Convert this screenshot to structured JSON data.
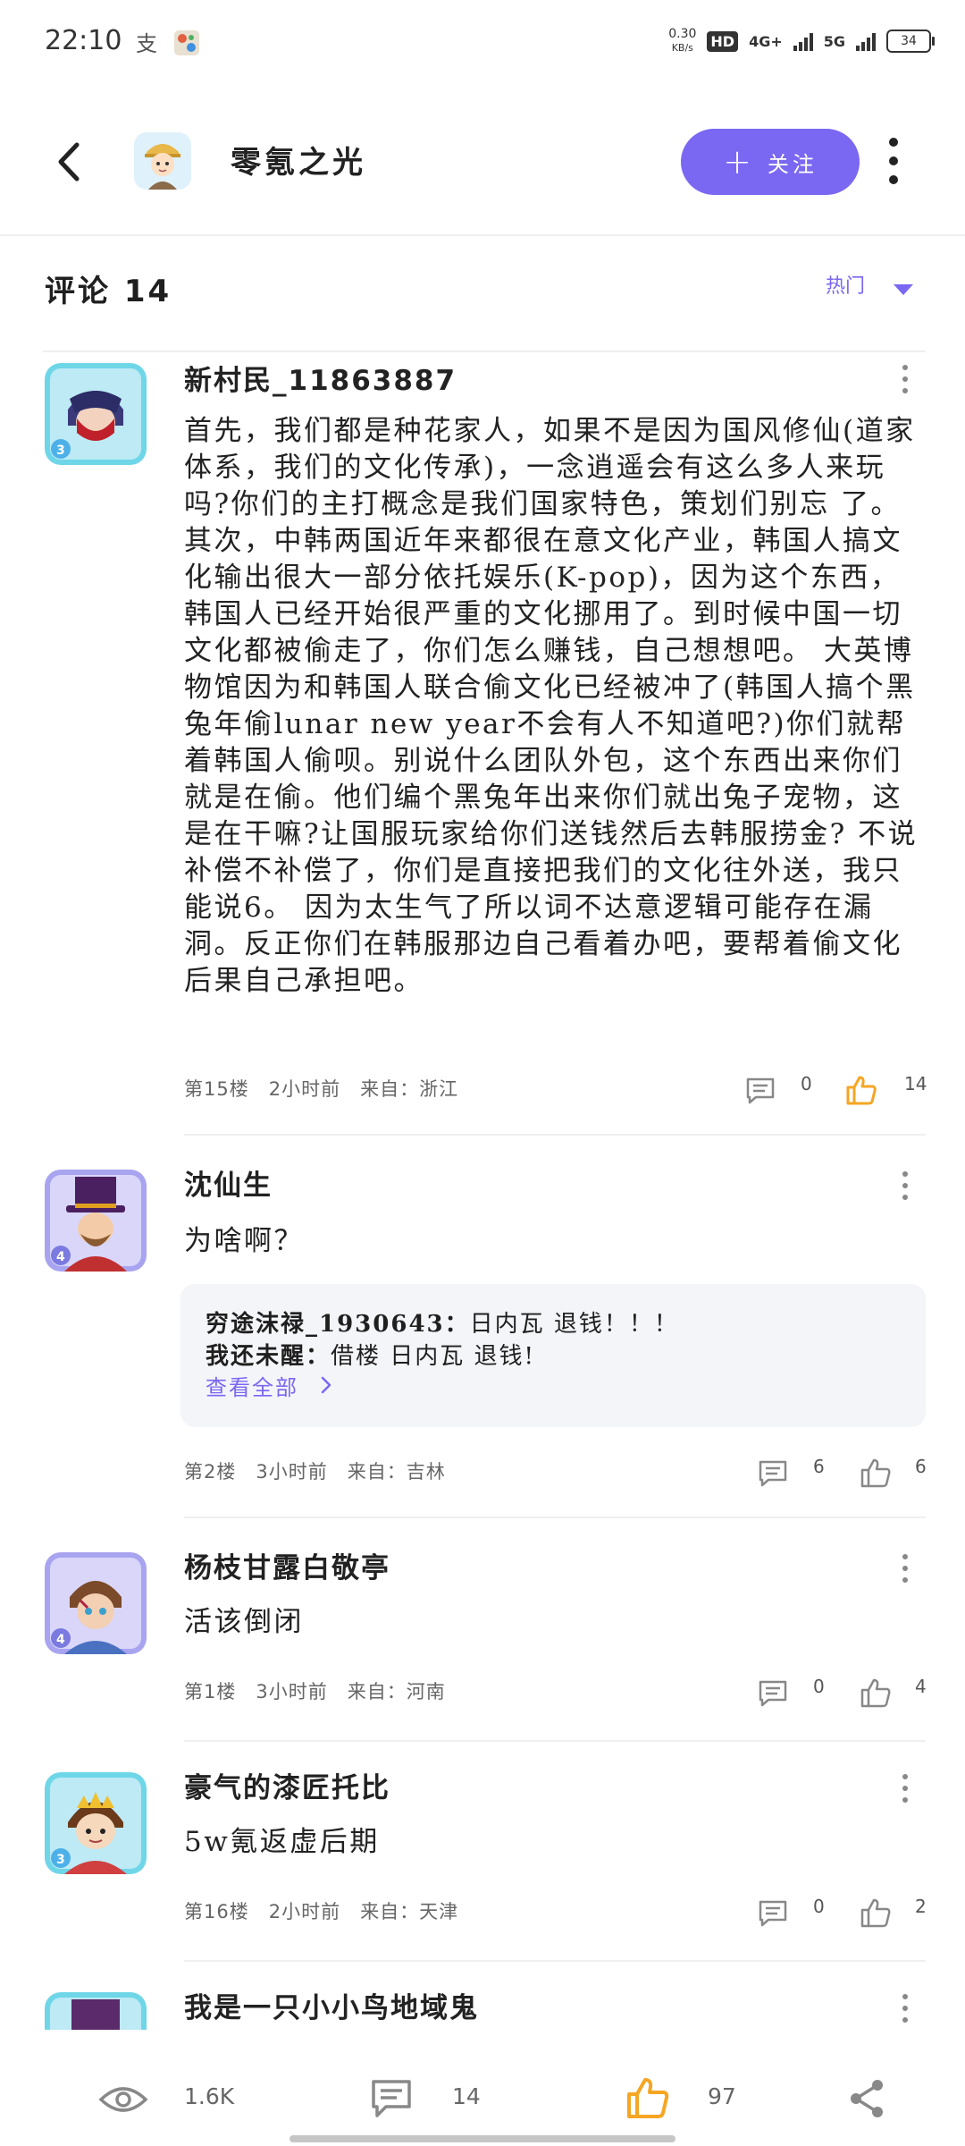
{
  "status_bar": {
    "time": "22:10",
    "net_speed_value": "0.30",
    "net_speed_unit": "KB/s",
    "hd_label": "HD",
    "network_1": "4G+",
    "network_2": "5G",
    "battery": "34"
  },
  "nav": {
    "author_name": "零氪之光",
    "follow_label": "关注"
  },
  "comments_section": {
    "title": "评论 14",
    "sort_label": "热门"
  },
  "comments": [
    {
      "username": "新村民_11863887",
      "text": "首先，我们都是种花家人，如果不是因为国风修仙(道家体系，我们的文化传承)，一念逍遥会有这么多人来玩吗?你们的主打概念是我们国家特色，策划们别忘 了。 其次，中韩两国近年来都很在意文化产业，韩国人搞文化输出很大一部分依托娱乐(K-pop)，因为这个东西，韩国人已经开始很严重的文化挪用了。到时候中国一切文化都被偷走了，你们怎么赚钱，自己想想吧。 大英博物馆因为和韩国人联合偷文化已经被冲了(韩国人搞个黑兔年偷lunar new year不会有人不知道吧?)你们就帮着韩国人偷呗。别说什么团队外包，这个东西出来你们就是在偷。他们编个黑兔年出来你们就出兔子宠物，这是在干嘛?让国服玩家给你们送钱然后去韩服捞金? 不说补偿不补偿了，你们是直接把我们的文化往外送，我只能说6。 因为太生气了所以词不达意逻辑可能存在漏洞。反正你们在韩服那边自己看着办吧，要帮着偷文化后果自己承担吧。",
      "floor": "第15楼",
      "time": "2小时前",
      "location": "来自：浙江",
      "replies": "0",
      "likes": "14",
      "liked": true
    },
    {
      "username": "沈仙生",
      "text": "为啥啊？",
      "reply_preview": [
        {
          "user": "穷途沫禄_1930643：",
          "text": "日内瓦 退钱！！！"
        },
        {
          "user": "我还未醒：",
          "text": "借楼 日内瓦 退钱!"
        }
      ],
      "view_all_label": "查看全部",
      "floor": "第2楼",
      "time": "3小时前",
      "location": "来自：吉林",
      "replies": "6",
      "likes": "6",
      "liked": false
    },
    {
      "username": "杨枝甘露白敬亭",
      "text": "活该倒闭",
      "floor": "第1楼",
      "time": "3小时前",
      "location": "来自：河南",
      "replies": "0",
      "likes": "4",
      "liked": false
    },
    {
      "username": "豪气的漆匠托比",
      "text": "5w氪返虚后期",
      "floor": "第16楼",
      "time": "2小时前",
      "location": "来自：天津",
      "replies": "0",
      "likes": "2",
      "liked": false
    },
    {
      "username": "我是一只小小鸟地域鬼"
    }
  ],
  "bottom_bar": {
    "views": "1.6K",
    "comments": "14",
    "likes": "97"
  },
  "colors": {
    "accent": "#7a67f2",
    "liked": "#f5a623"
  }
}
